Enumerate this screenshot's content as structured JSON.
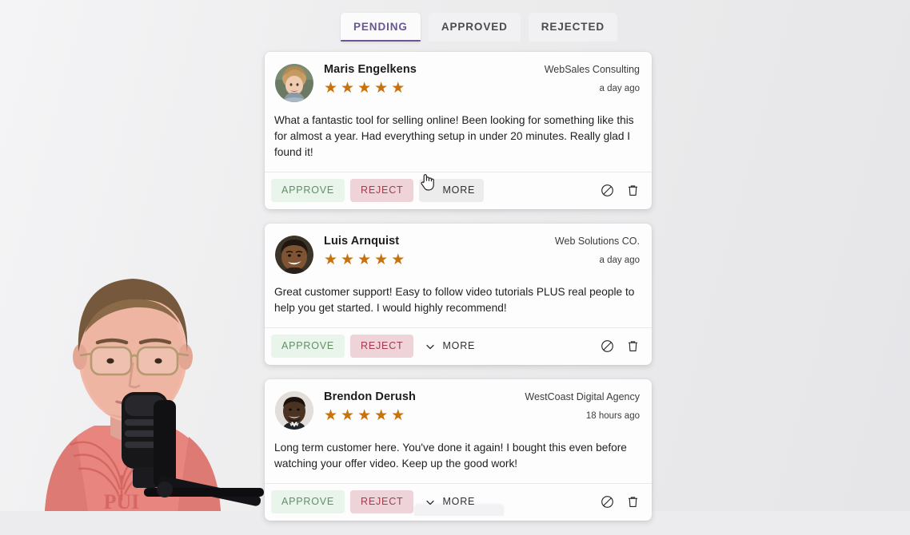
{
  "tabs": [
    {
      "id": "pending",
      "label": "PENDING",
      "active": true
    },
    {
      "id": "approved",
      "label": "APPROVED",
      "active": false
    },
    {
      "id": "rejected",
      "label": "REJECTED",
      "active": false
    }
  ],
  "colors": {
    "accent_purple": "#6c5496",
    "star_orange": "#c8720d",
    "approve_bg": "#e9f4ea",
    "approve_text": "#628f66",
    "reject_bg": "#eed3d8",
    "reject_text": "#a33b4e",
    "page_bg": "#ececee",
    "card_bg": "#fdfdfd"
  },
  "actions": {
    "approve_label": "APPROVE",
    "reject_label": "REJECT",
    "more_label": "MORE",
    "block_icon": "ban-icon",
    "delete_icon": "trash-icon",
    "chevron_icon": "chevron-down-icon"
  },
  "reviews": [
    {
      "name": "Maris Engelkens",
      "company": "WebSales Consulting",
      "rating": 5,
      "timestamp": "a day ago",
      "text": "What a fantastic tool for selling online! Been looking for something like this for almost a year. Had everything setup in under 20 minutes. Really glad I found it!",
      "avatar": "woman-blonde-avatar",
      "more_hovered": true
    },
    {
      "name": "Luis Arnquist",
      "company": "Web Solutions CO.",
      "rating": 5,
      "timestamp": "a day ago",
      "text": "Great customer support! Easy to follow video tutorials PLUS real people to help you get started. I would highly recommend!",
      "avatar": "man-smiling-avatar",
      "more_hovered": false
    },
    {
      "name": "Brendon Derush",
      "company": "WestCoast Digital Agency",
      "rating": 5,
      "timestamp": "18 hours ago",
      "text": "Long term customer here. You've done it again! I bought this even before watching your offer video. Keep up the good work!",
      "avatar": "man-suit-avatar",
      "more_hovered": false
    }
  ],
  "star_glyph": "★",
  "webcam": {
    "description": "presenter-webcam-overlay",
    "shirt_color": "#e8857e",
    "logo": "PUI"
  }
}
